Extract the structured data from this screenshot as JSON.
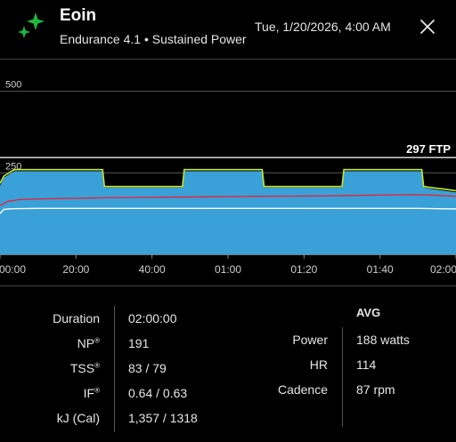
{
  "header": {
    "title": "Eoin",
    "subtitle": "Endurance 4.1 • Sustained Power",
    "datetime": "Tue, 1/20/2026, 4:00 AM",
    "icon": "sparkle-icon",
    "close_icon": "close-icon"
  },
  "colors": {
    "accent_green": "#1fb53f",
    "power_fill": "#3aa0d8",
    "target_line": "#c8e81e",
    "hr_line": "#e0283a",
    "cadence_line": "#ffffff",
    "ftp_line": "#ffffff"
  },
  "chart_data": {
    "type": "area",
    "title": "",
    "xlabel": "",
    "ylabel": "",
    "x_ticks": [
      "00:00",
      "20:00",
      "40:00",
      "01:00",
      "01:20",
      "01:40",
      "02:00"
    ],
    "x_tick_minutes": [
      0,
      20,
      40,
      60,
      80,
      100,
      120
    ],
    "xlim": [
      0,
      120
    ],
    "y_gridlines": [
      500,
      250
    ],
    "y_gridline_labels": [
      "500",
      "250"
    ],
    "ylim": [
      0,
      600
    ],
    "ftp": {
      "value": 297,
      "label": "297 FTP"
    },
    "series": [
      {
        "key": "power",
        "x": [
          0,
          1,
          3,
          4,
          27,
          27.5,
          48,
          48.5,
          69,
          69.5,
          90,
          90.5,
          111,
          111.5,
          114,
          117,
          120
        ],
        "y": [
          210,
          235,
          250,
          255,
          255,
          205,
          205,
          255,
          255,
          205,
          205,
          255,
          255,
          205,
          200,
          195,
          190
        ]
      },
      {
        "key": "target",
        "x": [
          0,
          1,
          3,
          4,
          27,
          27.5,
          48,
          48.5,
          69,
          69.5,
          90,
          90.5,
          111,
          111.5,
          114,
          117,
          120
        ],
        "y": [
          218,
          240,
          255,
          260,
          260,
          208,
          208,
          260,
          260,
          208,
          208,
          260,
          260,
          208,
          204,
          200,
          195
        ]
      },
      {
        "key": "hr",
        "x": [
          0,
          2,
          5,
          10,
          20,
          30,
          40,
          50,
          60,
          70,
          80,
          90,
          100,
          110,
          115,
          120
        ],
        "y": [
          150,
          162,
          168,
          170,
          172,
          174,
          175,
          176,
          177,
          178,
          179,
          180,
          182,
          183,
          181,
          178
        ]
      },
      {
        "key": "cadence",
        "x": [
          0,
          1,
          3,
          10,
          30,
          60,
          90,
          110,
          120
        ],
        "y": [
          125,
          138,
          140,
          141,
          141,
          141,
          141,
          141,
          139
        ]
      }
    ]
  },
  "stats": {
    "left": [
      {
        "label": "Duration",
        "reg": "",
        "value": "02:00:00"
      },
      {
        "label": "NP",
        "reg": "®",
        "value": "191"
      },
      {
        "label": "TSS",
        "reg": "®",
        "value": "83 / 79"
      },
      {
        "label": "IF",
        "reg": "®",
        "value": "0.64 / 0.63"
      },
      {
        "label": "kJ (Cal)",
        "reg": "",
        "value": "1,357 / 1318"
      }
    ],
    "avg_heading": "AVG",
    "right": [
      {
        "label": "Power",
        "value": "188 watts"
      },
      {
        "label": "HR",
        "value": "114"
      },
      {
        "label": "Cadence",
        "value": "87 rpm"
      }
    ]
  }
}
